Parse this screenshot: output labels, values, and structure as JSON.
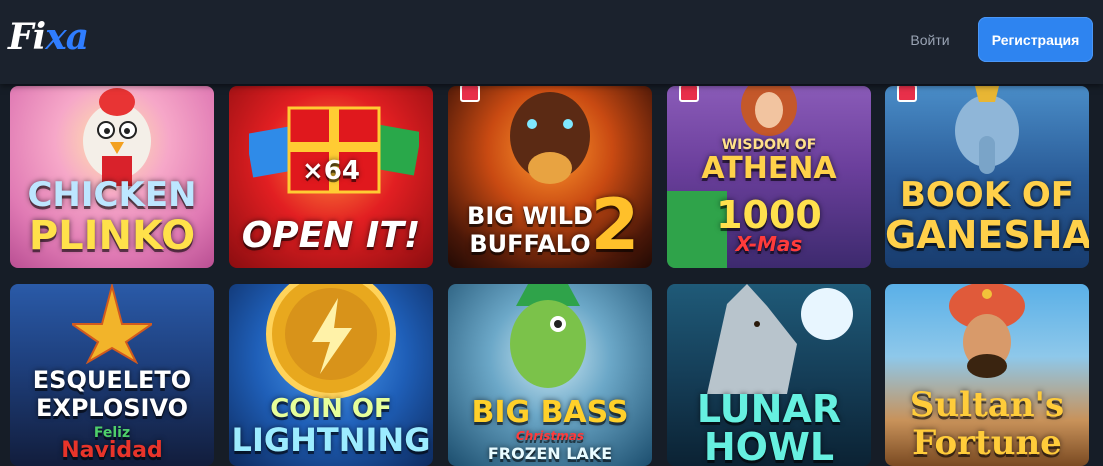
{
  "header": {
    "logo_main": "Fi",
    "logo_accent": "xa",
    "login_label": "Войти",
    "register_label": "Регистрация"
  },
  "games": [
    {
      "title_line1": "CHICKEN",
      "title_line2": "PLINKO"
    },
    {
      "title_line1": "×64",
      "title_line2": "OPEN IT!"
    },
    {
      "title_line1": "BIG WILD",
      "title_line2": "BUFFALO",
      "title_line3": "2"
    },
    {
      "title_line1": "WISDOM OF",
      "title_line2": "ATHENA",
      "title_line3": "1000",
      "title_line4": "X-Mas"
    },
    {
      "title_line1": "BOOK OF",
      "title_line2": "GANESHA"
    },
    {
      "title_line1": "ESQUELETO",
      "title_line2": "EXPLOSIVO",
      "title_line3": "Feliz",
      "title_line4": "Navidad"
    },
    {
      "title_line1": "COIN OF",
      "title_line2": "LIGHTNING"
    },
    {
      "title_line1": "BIG BASS",
      "title_line2": "Christmas",
      "title_line3": "FROZEN LAKE"
    },
    {
      "title_line1": "LUNAR",
      "title_line2": "HOWL"
    },
    {
      "title_line1": "Sultan's",
      "title_line2": "Fortune"
    }
  ],
  "colors": {
    "background": "#161d27",
    "header": "#1b222d",
    "accent": "#2e84f0",
    "login_text": "#9aa4b4"
  }
}
